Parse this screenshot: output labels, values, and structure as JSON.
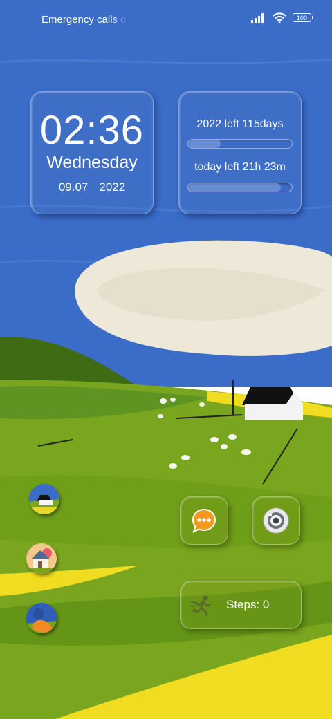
{
  "status_bar": {
    "carrier_text": "Emergency calls o",
    "signal_icon": "signal-bars-icon",
    "wifi_icon": "wifi-icon",
    "battery_level": "100"
  },
  "clock_widget": {
    "time": "02:36",
    "weekday": "Wednesday",
    "date": "09.07",
    "year": "2022"
  },
  "progress_widget": {
    "year_label": "2022 left 115days",
    "year_fraction": 0.31,
    "day_label": "today left 21h 23m",
    "day_fraction": 0.89
  },
  "shortcuts": {
    "app1_icon": "cottage-landscape-icon",
    "app2_icon": "house-sunset-icon",
    "app3_icon": "duck-icon"
  },
  "tiles": {
    "messages_icon": "chat-bubble-icon",
    "camera_icon": "camera-lens-icon"
  },
  "steps_widget": {
    "icon": "runner-icon",
    "text": "Steps: 0"
  },
  "colors": {
    "sky": "#3a6cc8",
    "grass": "#7aa51e",
    "field": "#f0dc20"
  }
}
